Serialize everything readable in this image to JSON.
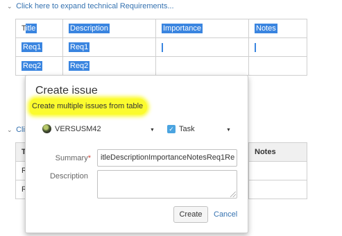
{
  "expanders": [
    {
      "chevron": "⌄",
      "label": "Click here to expand technical Requirements..."
    },
    {
      "chevron": "⌄",
      "label": "Clic"
    }
  ],
  "table1": {
    "headers": [
      "Title",
      "Description",
      "Importance",
      "Notes"
    ],
    "rows": [
      [
        "Req1",
        "Req1",
        "",
        ""
      ],
      [
        "Req2",
        "Req2",
        "",
        ""
      ]
    ]
  },
  "table2": {
    "headers": [
      "T",
      "",
      "",
      "Notes"
    ],
    "rows": [
      [
        "R",
        "",
        "",
        ""
      ],
      [
        "R",
        "",
        "",
        ""
      ]
    ]
  },
  "popup": {
    "title": "Create issue",
    "subtitle": "Create multiple issues from table",
    "project": "VERSUSM42",
    "issue_type": "Task",
    "summary_label": "Summary",
    "summary_required": "*",
    "summary_value": "itleDescriptionImportanceNotesReq1Re",
    "description_label": "Description",
    "create_label": "Create",
    "cancel_label": "Cancel"
  },
  "colors": {
    "link": "#3572b0",
    "selection": "#3a85e0",
    "highlight": "#fbfb2e"
  }
}
